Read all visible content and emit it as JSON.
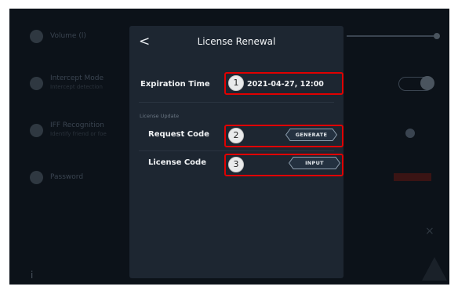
{
  "background": {
    "rows": [
      {
        "label": "Volume (l)",
        "sub": ""
      },
      {
        "label": "Intercept Mode",
        "sub": "Intercept detection"
      },
      {
        "label": "IFF Recognition",
        "sub": "Identify friend or foe"
      },
      {
        "label": "Password",
        "sub": ""
      }
    ],
    "toggle_text": "",
    "info_icon": "i",
    "close_icon": "×"
  },
  "modal": {
    "title": "License Renewal",
    "back_icon": "<",
    "expiration_label": "Expiration Time",
    "expiration_value": "2021-04-27, 12:00",
    "section_label": "License Update",
    "request_label": "Request Code",
    "request_button": "GENERATE",
    "license_label": "License Code",
    "license_button": "INPUT"
  },
  "annotations": [
    {
      "number": "1"
    },
    {
      "number": "2"
    },
    {
      "number": "3"
    }
  ],
  "colors": {
    "annotation_red": "#e00000",
    "modal_bg": "#1d2631",
    "screen_bg": "#0c1219"
  }
}
